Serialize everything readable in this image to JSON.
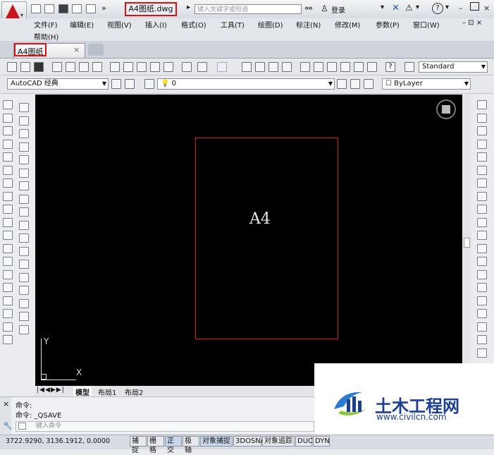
{
  "title_bar": {
    "file_name": "A4图纸.dwg",
    "search_placeholder": "键入关键字或短语",
    "login_label": "登录",
    "help_icon": "?",
    "min": "–",
    "close": "×"
  },
  "menu": {
    "items": [
      "文件(F)",
      "编辑(E)",
      "视图(V)",
      "插入(I)",
      "格式(O)",
      "工具(T)",
      "绘图(D)",
      "标注(N)",
      "修改(M)",
      "参数(P)",
      "窗口(W)",
      "帮助(H)"
    ],
    "controls": "– ⊡ ×"
  },
  "document_tab": {
    "label": "A4图纸",
    "close": "×"
  },
  "toolbar": {
    "text_style": "Standard",
    "workspace": "AutoCAD 经典",
    "layer": "0",
    "color": "ByLayer"
  },
  "canvas": {
    "drawing_label": "A4",
    "ucs_x": "X",
    "ucs_y": "Y",
    "border_color": "#d42020"
  },
  "layout_tabs": [
    "模型",
    "布局1",
    "布局2"
  ],
  "command_line": {
    "history": [
      "命令:",
      "命令: _QSAVE"
    ],
    "input_placeholder": "键入命令"
  },
  "status_bar": {
    "coordinates": "3722.9290, 3136.1912, 0.0000",
    "buttons": [
      {
        "label": "捕捉",
        "on": false
      },
      {
        "label": "栅格",
        "on": false
      },
      {
        "label": "正交",
        "on": true
      },
      {
        "label": "极轴",
        "on": false
      },
      {
        "label": "对象捕捉",
        "on": true
      },
      {
        "label": "3DOSNAP",
        "on": false
      },
      {
        "label": "对象追踪",
        "on": false
      },
      {
        "label": "DUCS",
        "on": false
      },
      {
        "label": "DYN",
        "on": false
      }
    ]
  },
  "watermark": {
    "name": "土木工程网",
    "url": "www.civilcn.com"
  }
}
